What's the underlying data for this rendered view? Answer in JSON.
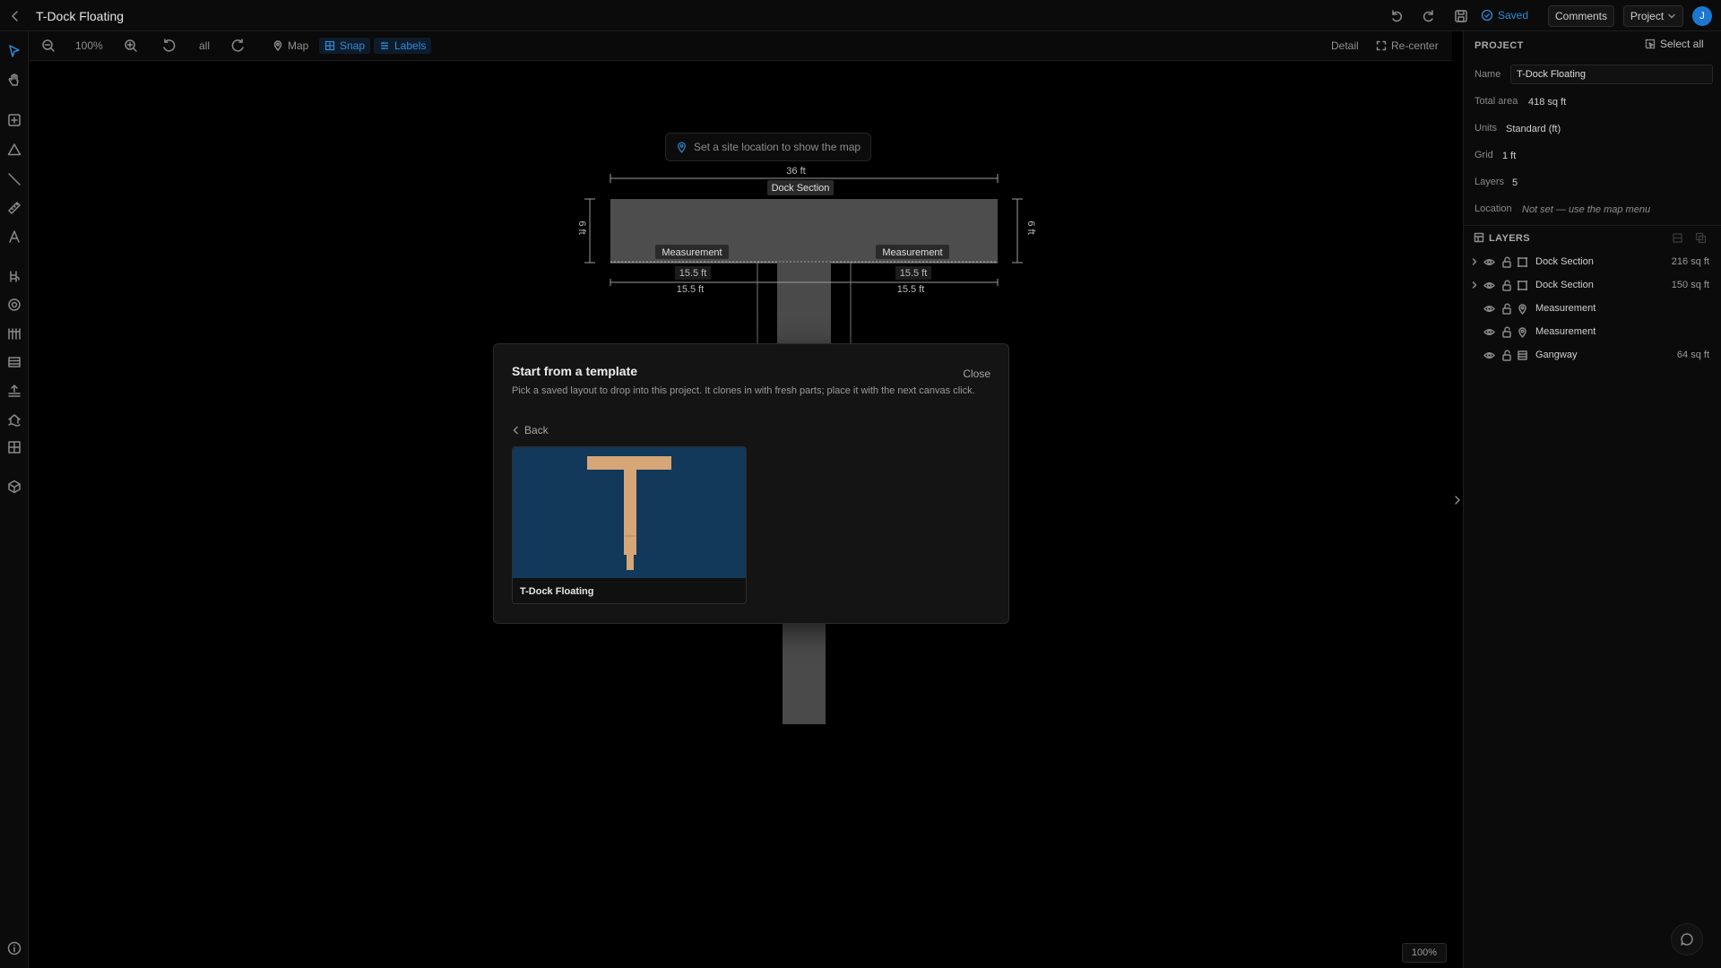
{
  "app": {
    "title": "T-Dock Floating"
  },
  "topbar": {
    "saved_label": "Saved",
    "comments_label": "Comments",
    "project_label": "Project",
    "avatar_initial": "J",
    "accent_color": "#2f8cd8"
  },
  "canvas_toolbar": {
    "zoom_level": "100%",
    "rotate_all_label": "all",
    "map_label": "Map",
    "snap_label": "Snap",
    "labels_label": "Labels",
    "detail_label": "Detail",
    "recenter_label": "Re-center"
  },
  "canvas": {
    "map_hint": "Set a site location to show the map",
    "bottom_zoom": "100%",
    "drawing": {
      "dock_section_label": "Dock Section",
      "width_dimension": "36 ft",
      "left_depth": "6 ft",
      "right_depth": "6 ft",
      "measurement_left_label": "Measurement",
      "measurement_right_label": "Measurement",
      "left_inner_dimension": "15.5 ft",
      "left_outer_dimension": "15.5 ft",
      "right_inner_dimension": "15.5 ft",
      "right_outer_dimension": "15.5 ft"
    }
  },
  "modal": {
    "title": "Start from a template",
    "close_label": "Close",
    "description": "Pick a saved layout to drop into this project. It clones in with fresh parts; place it with the next canvas click.",
    "back_label": "Back",
    "templates": [
      {
        "name": "T-Dock Floating",
        "thumb_bg": "#12385a",
        "dock_color": "#d6a677"
      }
    ]
  },
  "project_panel": {
    "header": "PROJECT",
    "select_all_label": "Select all",
    "name_label": "Name",
    "name_value": "T-Dock Floating",
    "total_area_label": "Total area",
    "total_area_value": "418 sq ft",
    "units_label": "Units",
    "units_value": "Standard (ft)",
    "grid_label": "Grid",
    "grid_value": "1 ft",
    "layers_label": "Layers",
    "layers_value": "5",
    "location_label": "Location",
    "location_value": "Not set — use the map menu"
  },
  "layers_panel": {
    "header": "LAYERS",
    "items": [
      {
        "name": "Dock Section",
        "area": "216 sq ft",
        "type": "section",
        "expandable": true
      },
      {
        "name": "Dock Section",
        "area": "150 sq ft",
        "type": "section",
        "expandable": true
      },
      {
        "name": "Measurement",
        "area": "",
        "type": "measurement",
        "expandable": false
      },
      {
        "name": "Measurement",
        "area": "",
        "type": "measurement",
        "expandable": false
      },
      {
        "name": "Gangway",
        "area": "64 sq ft",
        "type": "gangway",
        "expandable": false
      }
    ]
  }
}
